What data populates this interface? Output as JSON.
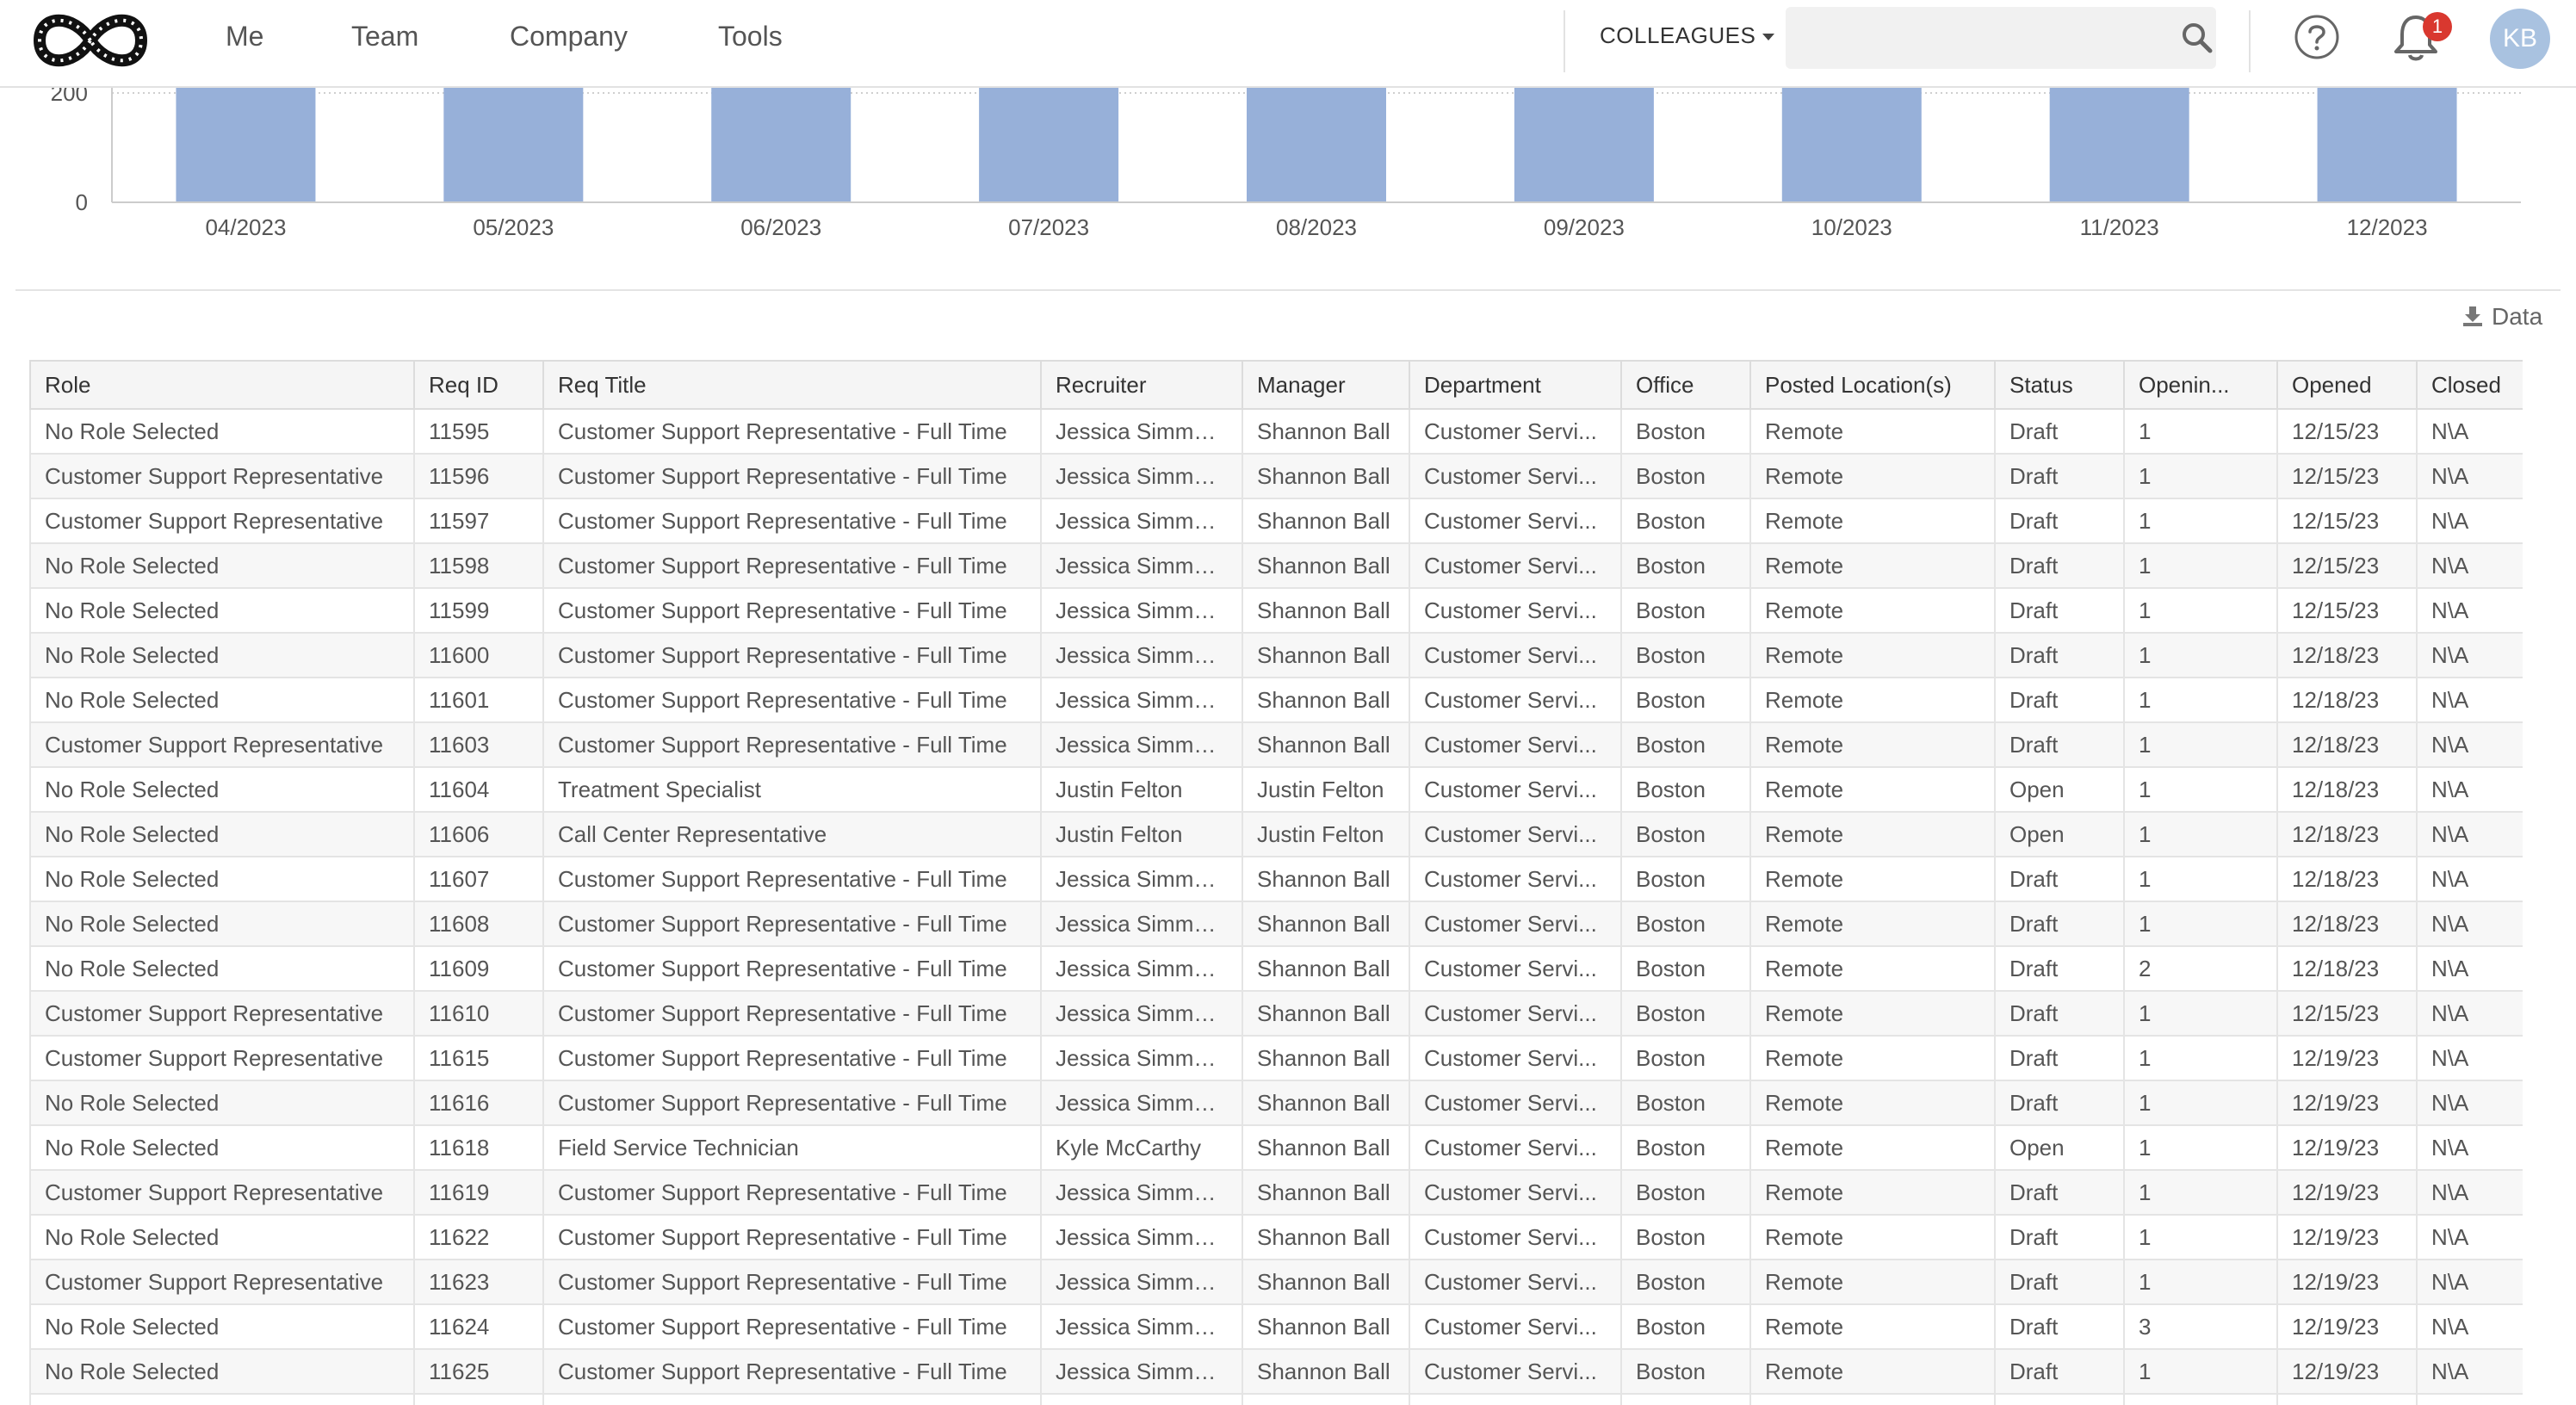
{
  "nav": {
    "items": [
      "Me",
      "Team",
      "Company",
      "Tools"
    ],
    "colleagues_label": "COLLEAGUES",
    "search_placeholder": "",
    "notification_count": "1",
    "avatar_initials": "KB",
    "logo_icon": "infinity-leopard-logo",
    "search_icon": "search-icon",
    "help_icon": "help-circle-icon",
    "bell_icon": "bell-icon"
  },
  "chart_data": {
    "type": "bar",
    "categories": [
      "04/2023",
      "05/2023",
      "06/2023",
      "07/2023",
      "08/2023",
      "09/2023",
      "10/2023",
      "11/2023",
      "12/2023"
    ],
    "values": [
      200,
      200,
      200,
      200,
      200,
      200,
      200,
      200,
      200
    ],
    "y_ticks": [
      "0",
      "200"
    ],
    "ylim": [
      0,
      200
    ],
    "bar_color": "#97b0d9",
    "title": "",
    "xlabel": "",
    "ylabel": ""
  },
  "export": {
    "label": "Data",
    "icon": "download-icon"
  },
  "table": {
    "columns": [
      "Role",
      "Req ID",
      "Req Title",
      "Recruiter",
      "Manager",
      "Department",
      "Office",
      "Posted Location(s)",
      "Status",
      "Openin...",
      "Opened",
      "Closed"
    ],
    "rows": [
      [
        "No Role Selected",
        "11595",
        "Customer Support Representative - Full Time",
        "Jessica Simmons",
        "Shannon Ball",
        "Customer Servi...",
        "Boston",
        "Remote",
        "Draft",
        "1",
        "12/15/23",
        "N\\A"
      ],
      [
        "Customer Support Representative",
        "11596",
        "Customer Support Representative - Full Time",
        "Jessica Simmons",
        "Shannon Ball",
        "Customer Servi...",
        "Boston",
        "Remote",
        "Draft",
        "1",
        "12/15/23",
        "N\\A"
      ],
      [
        "Customer Support Representative",
        "11597",
        "Customer Support Representative - Full Time",
        "Jessica Simmons",
        "Shannon Ball",
        "Customer Servi...",
        "Boston",
        "Remote",
        "Draft",
        "1",
        "12/15/23",
        "N\\A"
      ],
      [
        "No Role Selected",
        "11598",
        "Customer Support Representative - Full Time",
        "Jessica Simmons",
        "Shannon Ball",
        "Customer Servi...",
        "Boston",
        "Remote",
        "Draft",
        "1",
        "12/15/23",
        "N\\A"
      ],
      [
        "No Role Selected",
        "11599",
        "Customer Support Representative - Full Time",
        "Jessica Simmons",
        "Shannon Ball",
        "Customer Servi...",
        "Boston",
        "Remote",
        "Draft",
        "1",
        "12/15/23",
        "N\\A"
      ],
      [
        "No Role Selected",
        "11600",
        "Customer Support Representative - Full Time",
        "Jessica Simmons",
        "Shannon Ball",
        "Customer Servi...",
        "Boston",
        "Remote",
        "Draft",
        "1",
        "12/18/23",
        "N\\A"
      ],
      [
        "No Role Selected",
        "11601",
        "Customer Support Representative - Full Time",
        "Jessica Simmons",
        "Shannon Ball",
        "Customer Servi...",
        "Boston",
        "Remote",
        "Draft",
        "1",
        "12/18/23",
        "N\\A"
      ],
      [
        "Customer Support Representative",
        "11603",
        "Customer Support Representative - Full Time",
        "Jessica Simmons",
        "Shannon Ball",
        "Customer Servi...",
        "Boston",
        "Remote",
        "Draft",
        "1",
        "12/18/23",
        "N\\A"
      ],
      [
        "No Role Selected",
        "11604",
        "Treatment Specialist",
        "Justin Felton",
        "Justin Felton",
        "Customer Servi...",
        "Boston",
        "Remote",
        "Open",
        "1",
        "12/18/23",
        "N\\A"
      ],
      [
        "No Role Selected",
        "11606",
        "Call Center Representative",
        "Justin Felton",
        "Justin Felton",
        "Customer Servi...",
        "Boston",
        "Remote",
        "Open",
        "1",
        "12/18/23",
        "N\\A"
      ],
      [
        "No Role Selected",
        "11607",
        "Customer Support Representative - Full Time",
        "Jessica Simmons",
        "Shannon Ball",
        "Customer Servi...",
        "Boston",
        "Remote",
        "Draft",
        "1",
        "12/18/23",
        "N\\A"
      ],
      [
        "No Role Selected",
        "11608",
        "Customer Support Representative - Full Time",
        "Jessica Simmons",
        "Shannon Ball",
        "Customer Servi...",
        "Boston",
        "Remote",
        "Draft",
        "1",
        "12/18/23",
        "N\\A"
      ],
      [
        "No Role Selected",
        "11609",
        "Customer Support Representative - Full Time",
        "Jessica Simmons",
        "Shannon Ball",
        "Customer Servi...",
        "Boston",
        "Remote",
        "Draft",
        "2",
        "12/18/23",
        "N\\A"
      ],
      [
        "Customer Support Representative",
        "11610",
        "Customer Support Representative - Full Time",
        "Jessica Simmons",
        "Shannon Ball",
        "Customer Servi...",
        "Boston",
        "Remote",
        "Draft",
        "1",
        "12/15/23",
        "N\\A"
      ],
      [
        "Customer Support Representative",
        "11615",
        "Customer Support Representative - Full Time",
        "Jessica Simmons",
        "Shannon Ball",
        "Customer Servi...",
        "Boston",
        "Remote",
        "Draft",
        "1",
        "12/19/23",
        "N\\A"
      ],
      [
        "No Role Selected",
        "11616",
        "Customer Support Representative - Full Time",
        "Jessica Simmons",
        "Shannon Ball",
        "Customer Servi...",
        "Boston",
        "Remote",
        "Draft",
        "1",
        "12/19/23",
        "N\\A"
      ],
      [
        "No Role Selected",
        "11618",
        "Field Service Technician",
        "Kyle McCarthy",
        "Shannon Ball",
        "Customer Servi...",
        "Boston",
        "Remote",
        "Open",
        "1",
        "12/19/23",
        "N\\A"
      ],
      [
        "Customer Support Representative",
        "11619",
        "Customer Support Representative - Full Time",
        "Jessica Simmons",
        "Shannon Ball",
        "Customer Servi...",
        "Boston",
        "Remote",
        "Draft",
        "1",
        "12/19/23",
        "N\\A"
      ],
      [
        "No Role Selected",
        "11622",
        "Customer Support Representative - Full Time",
        "Jessica Simmons",
        "Shannon Ball",
        "Customer Servi...",
        "Boston",
        "Remote",
        "Draft",
        "1",
        "12/19/23",
        "N\\A"
      ],
      [
        "Customer Support Representative",
        "11623",
        "Customer Support Representative - Full Time",
        "Jessica Simmons",
        "Shannon Ball",
        "Customer Servi...",
        "Boston",
        "Remote",
        "Draft",
        "1",
        "12/19/23",
        "N\\A"
      ],
      [
        "No Role Selected",
        "11624",
        "Customer Support Representative - Full Time",
        "Jessica Simmons",
        "Shannon Ball",
        "Customer Servi...",
        "Boston",
        "Remote",
        "Draft",
        "3",
        "12/19/23",
        "N\\A"
      ],
      [
        "No Role Selected",
        "11625",
        "Customer Support Representative - Full Time",
        "Jessica Simmons",
        "Shannon Ball",
        "Customer Servi...",
        "Boston",
        "Remote",
        "Draft",
        "1",
        "12/19/23",
        "N\\A"
      ],
      [
        "",
        "",
        "",
        "",
        "",
        "",
        "",
        "",
        "",
        "",
        "",
        ""
      ]
    ]
  }
}
